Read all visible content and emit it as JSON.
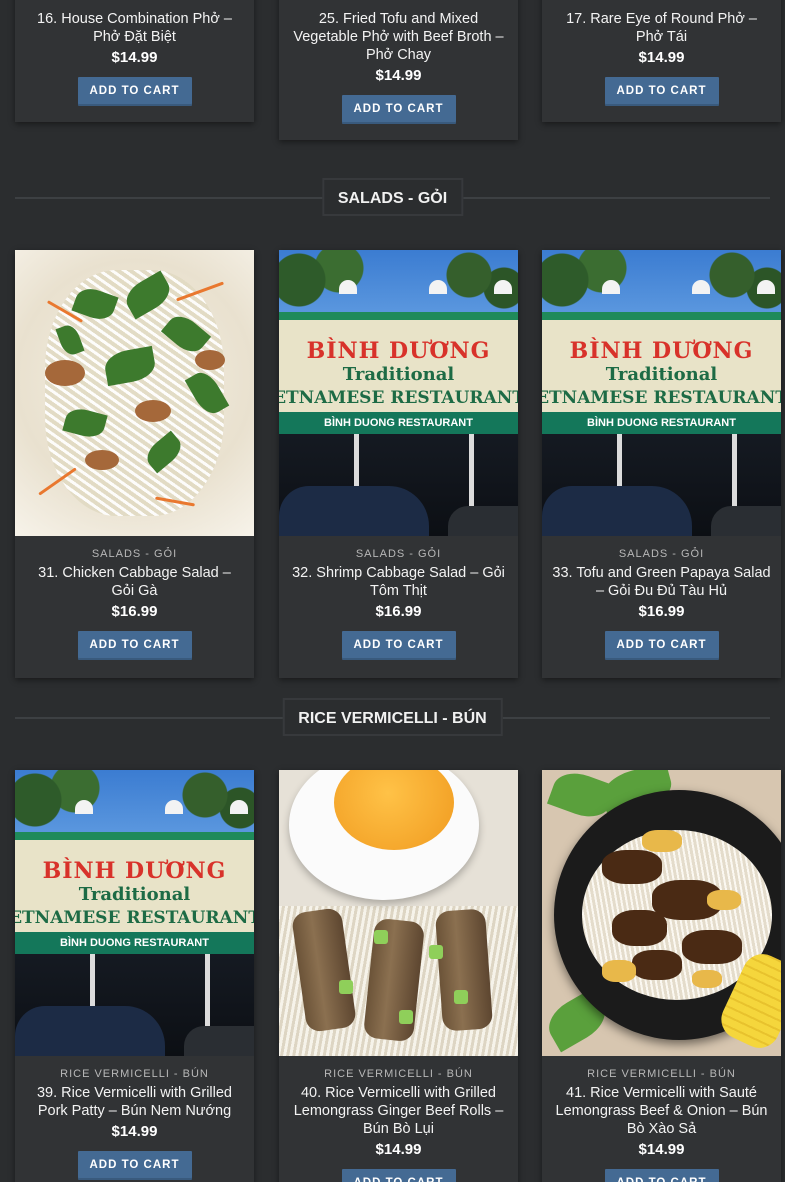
{
  "colors": {
    "background": "#2b2d2f",
    "card": "#313335",
    "button": "#446a93",
    "button_text": "#ffffff"
  },
  "top_products": [
    {
      "title": "16. House Combination Phở – Phở Đặt Biệt",
      "price": "$14.99",
      "button": "ADD TO CART"
    },
    {
      "title": "25. Fried Tofu and Mixed Vegetable Phở with Beef Broth – Phở Chay",
      "price": "$14.99",
      "button": "ADD TO CART"
    },
    {
      "title": "17. Rare Eye of Round Phở – Phở Tái",
      "price": "$14.99",
      "button": "ADD TO CART"
    }
  ],
  "sections": [
    {
      "title": "SALADS - GỎI",
      "products": [
        {
          "category": "SALADS - GỎI",
          "title": "31. Chicken Cabbage Salad – Gỏi Gà",
          "price": "$16.99",
          "button": "ADD TO CART",
          "image": "salad-photo"
        },
        {
          "category": "SALADS - GỎI",
          "title": "32. Shrimp Cabbage Salad – Gỏi Tôm Thịt",
          "price": "$16.99",
          "button": "ADD TO CART",
          "image": "storefront-photo"
        },
        {
          "category": "SALADS - GỎI",
          "title": "33. Tofu and Green Papaya Salad – Gỏi Đu Đủ Tàu Hủ",
          "price": "$16.99",
          "button": "ADD TO CART",
          "image": "storefront-photo"
        }
      ]
    },
    {
      "title": "RICE VERMICELLI - BÚN",
      "products": [
        {
          "category": "RICE VERMICELLI - BÚN",
          "title": "39. Rice Vermicelli with Grilled Pork Patty – Bún Nem Nướng",
          "price": "$14.99",
          "button": "ADD TO CART",
          "image": "storefront-photo"
        },
        {
          "category": "RICE VERMICELLI - BÚN",
          "title": "40. Rice Vermicelli with Grilled Lemongrass Ginger Beef Rolls – Bún Bò Lụi",
          "price": "$14.99",
          "button": "ADD TO CART",
          "image": "grilled-rolls-photo"
        },
        {
          "category": "RICE VERMICELLI - BÚN",
          "title": "41. Rice Vermicelli with Sauté Lemongrass Beef & Onion – Bún Bò Xào Sả",
          "price": "$14.99",
          "button": "ADD TO CART",
          "image": "beef-noodle-bowl-photo"
        }
      ]
    }
  ],
  "storefront_sign": {
    "line1": "BÌNH DƯƠNG",
    "line2": "Traditional",
    "line3": "ETNAMESE RESTAURANT",
    "band": "BÌNH DUONG RESTAURANT"
  }
}
